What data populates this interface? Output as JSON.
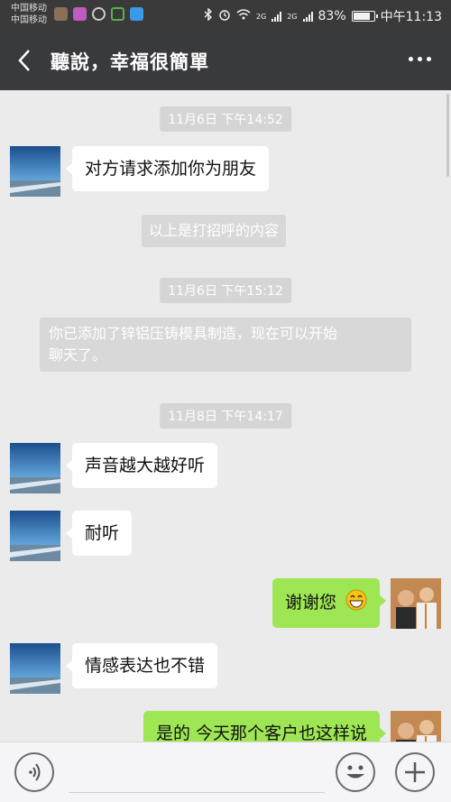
{
  "status_bar": {
    "carrier1": "中国移动",
    "carrier2": "中国移动",
    "network1": "2G",
    "network2": "2G",
    "battery": "83%",
    "battery_level": 0.83,
    "time": "中午11:13",
    "icons": [
      "bluetooth-icon",
      "alarm-icon",
      "wifi-icon",
      "signal-icon",
      "battery-icon"
    ]
  },
  "header": {
    "title": "聽說，幸福很簡單",
    "back_icon": "back-arrow-icon",
    "menu_icon": "more-dots-icon"
  },
  "messages": {
    "t1": "11月6日 下午14:52",
    "m1": "对方请求添加你为朋友",
    "s1": "以上是打招呼的内容",
    "t2": "11月6日 下午15:12",
    "s2_line1": "你已添加了锌铝压铸模具制造，现在可以开始",
    "s2_line2": "聊天了。",
    "t3": "11月8日 下午14:17",
    "m2": "声音越大越好听",
    "m3": "耐听",
    "m4": "谢谢您",
    "m5": "情感表达也不错",
    "m6": "是的 今天那个客户也这样说"
  },
  "input_bar": {
    "voice_icon": "voice-icon",
    "emoji_icon": "emoji-icon",
    "plus_icon": "plus-icon"
  },
  "colors": {
    "header_bg": "#393a3e",
    "chat_bg": "#ebebeb",
    "sent_bubble": "#9fe655",
    "received_bubble": "#ffffff"
  }
}
